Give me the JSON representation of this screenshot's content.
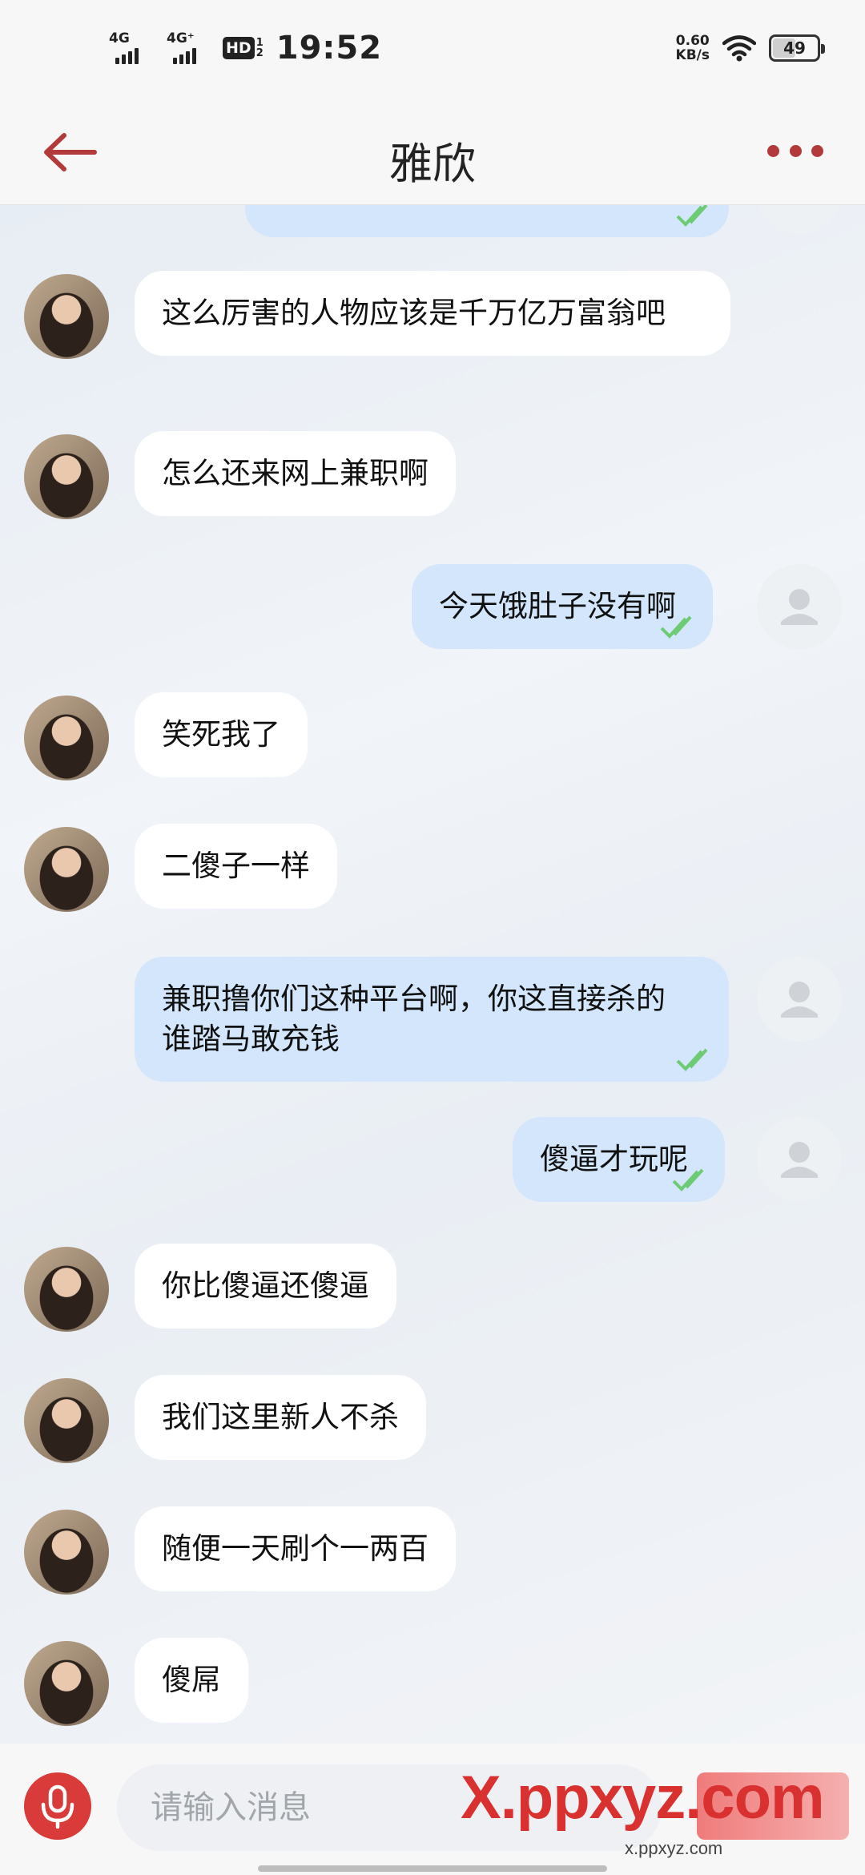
{
  "status_bar": {
    "network1": "4G",
    "network2": "4G⁺",
    "hd": "HD",
    "hd_sub_top": "1",
    "hd_sub_bottom": "2",
    "time": "19:52",
    "speed_value": "0.60",
    "speed_unit": "KB/s",
    "battery": "49"
  },
  "header": {
    "title": "雅欣"
  },
  "messages": [
    {
      "side": "right",
      "text": "",
      "read": true
    },
    {
      "side": "left",
      "text": "这么厉害的人物应该是千万亿万富翁吧"
    },
    {
      "side": "left",
      "text": "怎么还来网上兼职啊"
    },
    {
      "side": "right",
      "text": "今天饿肚子没有啊",
      "read": true
    },
    {
      "side": "left",
      "text": "笑死我了"
    },
    {
      "side": "left",
      "text": "二傻子一样"
    },
    {
      "side": "right",
      "text": "兼职撸你们这种平台啊，你这直接杀的谁踏马敢充钱",
      "read": true
    },
    {
      "side": "right",
      "text": "傻逼才玩呢",
      "read": true
    },
    {
      "side": "left",
      "text": "你比傻逼还傻逼"
    },
    {
      "side": "left",
      "text": "我们这里新人不杀"
    },
    {
      "side": "left",
      "text": "随便一天刷个一两百"
    },
    {
      "side": "left",
      "text": "傻屌"
    }
  ],
  "input_bar": {
    "placeholder": "请输入消息",
    "watermark": "X.ppxyz.com",
    "watermark_url": "x.ppxyz.com"
  },
  "colors": {
    "accent": "#B23A3A",
    "mic": "#D93A3A",
    "outgoing_bubble": "#D3E6FB",
    "incoming_bubble": "#FFFFFF",
    "read_ticks": "#6CCB73"
  }
}
